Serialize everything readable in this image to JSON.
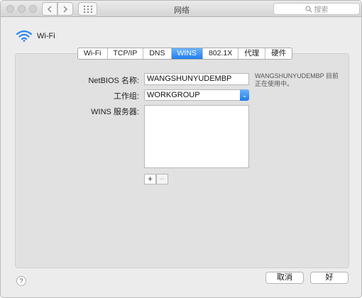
{
  "window": {
    "title": "网络"
  },
  "search": {
    "placeholder": "搜索"
  },
  "network": {
    "name": "Wi-Fi"
  },
  "tabs": [
    {
      "label": "Wi-Fi"
    },
    {
      "label": "TCP/IP"
    },
    {
      "label": "DNS"
    },
    {
      "label": "WINS"
    },
    {
      "label": "802.1X"
    },
    {
      "label": "代理"
    },
    {
      "label": "硬件"
    }
  ],
  "active_tab": "WINS",
  "wins": {
    "netbios_label": "NetBIOS 名称:",
    "netbios_value": "WANGSHUNYUDEMBP",
    "netbios_note_line1": "WANGSHUNYUDEMBP 目前",
    "netbios_note_line2": "正在使用中。",
    "workgroup_label": "工作组:",
    "workgroup_value": "WORKGROUP",
    "servers_label": "WINS 服务器:",
    "servers": []
  },
  "buttons": {
    "add": "+",
    "remove": "−",
    "help": "?",
    "cancel": "取消",
    "ok": "好"
  },
  "colors": {
    "accent": "#1f7cf0",
    "wifi_icon": "#2d86f6"
  }
}
